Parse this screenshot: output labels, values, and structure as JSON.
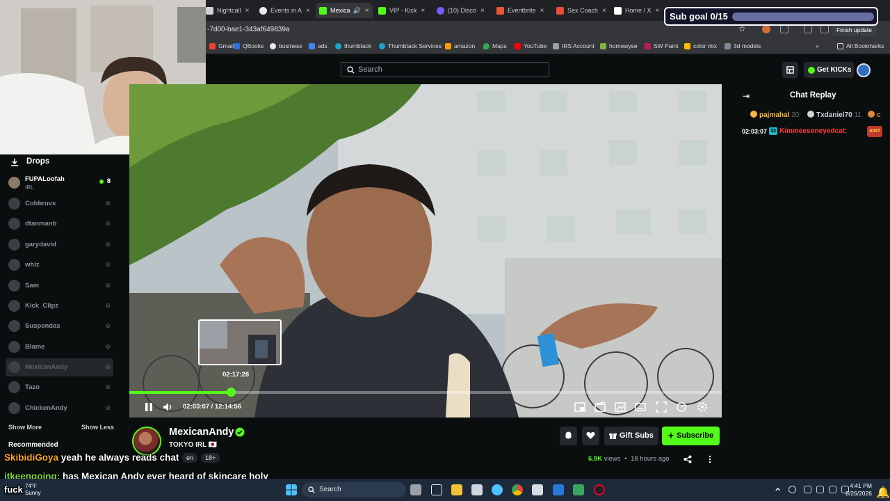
{
  "browser": {
    "tabs": [
      {
        "title": "Nightcall",
        "color": "#d0d2d5"
      },
      {
        "title": "Events in A",
        "color": "#e8eaed"
      },
      {
        "title": "Mexica",
        "color": "#53fc18",
        "active": true
      },
      {
        "title": "VIP - Kick",
        "color": "#53fc18"
      },
      {
        "title": "(10) Disco",
        "color": "#7a5af8"
      },
      {
        "title": "Eventbrite",
        "color": "#f05537"
      },
      {
        "title": "Sex Coach",
        "color": "#e74c3c"
      },
      {
        "title": "Home / X",
        "color": "#ffffff"
      }
    ],
    "tab_close": "×",
    "url": "-7d00-bae1-343af649839a",
    "finish_update": "Finish update",
    "bookmarks": [
      {
        "label": "Gmail",
        "color": "#ea4335"
      },
      {
        "label": "QBooks",
        "color": "#2f6fd6"
      },
      {
        "label": "business",
        "color": "#e8eaed"
      },
      {
        "label": "ads",
        "color": "#4285f4"
      },
      {
        "label": "thumbtack",
        "color": "#19a7d2"
      },
      {
        "label": "Thumbtack Services",
        "color": "#19a7d2"
      },
      {
        "label": "amazon",
        "color": "#ff9900"
      },
      {
        "label": "Maps",
        "color": "#34a853"
      },
      {
        "label": "YouTube",
        "color": "#ff0000"
      },
      {
        "label": "IRS Account",
        "color": "#9aa0a6"
      },
      {
        "label": "homewyse",
        "color": "#7cb342"
      },
      {
        "label": "SW Paint",
        "color": "#c2185b"
      },
      {
        "label": "color mix",
        "color": "#fbbc05"
      },
      {
        "label": "3d models",
        "color": "#7e8a97"
      }
    ],
    "all_bookmarks": "All Bookmarks"
  },
  "subgoal": {
    "label": "Sub goal 0/15",
    "progress": 0
  },
  "kick": {
    "search_placeholder": "Search",
    "get_kicks": "Get KICKs"
  },
  "sidebar": {
    "drops": "Drops",
    "featured": {
      "name": "FUPALoofah",
      "category": "IRL",
      "viewers": "8"
    },
    "channels": [
      {
        "name": "Cobbruvs"
      },
      {
        "name": "dtanmanb"
      },
      {
        "name": "garydavid"
      },
      {
        "name": "whiz"
      },
      {
        "name": "Sam"
      },
      {
        "name": "Kick_Clipz"
      },
      {
        "name": "Suspendas"
      },
      {
        "name": "Blame"
      },
      {
        "name": "MexicanAndy",
        "selected": true
      },
      {
        "name": "Tazo"
      },
      {
        "name": "ChickenAndy"
      }
    ],
    "show_more": "Show More",
    "show_less": "Show Less",
    "recommended": "Recommended"
  },
  "player": {
    "preview_time": "02:17:28",
    "current_time": "02:03:07",
    "duration": "12:14:56",
    "time_separator": "/",
    "progress": 0.171
  },
  "chat": {
    "title": "Chat Replay",
    "gifters": [
      {
        "name": "pajmahal",
        "count": "20",
        "color": "#f5b83d"
      },
      {
        "name": "Txdaniel70",
        "count": "11",
        "color": "#d0d2d5"
      },
      {
        "name": "c",
        "count": "",
        "color": "#e0883a"
      }
    ],
    "message": {
      "time": "02:03:07",
      "badge": "33",
      "user": "Kimmeesoneyedcat:",
      "emote": "AINT"
    }
  },
  "stream": {
    "name": "MexicanAndy",
    "category": "TOKYO IRL 🇯🇵",
    "tags": [
      "en",
      "18+"
    ],
    "gift_subs": "Gift Subs",
    "subscribe": "Subscribe",
    "views": "6.9K",
    "views_label": "views",
    "separator": "•",
    "ago": "18 hours ago"
  },
  "overlay_chat": [
    {
      "user": "SkibidiGoya",
      "text": "yeah he always reads chat"
    },
    {
      "user": "itkeengoing:",
      "text": "has Mexican Andy ever heard of skincare holy"
    },
    {
      "user": "",
      "text": "fuck"
    }
  ],
  "taskbar": {
    "weather_temp": "74°F",
    "weather_desc": "Sunny",
    "search": "Search",
    "time": "4:41 PM",
    "date": "8/26/2026"
  }
}
